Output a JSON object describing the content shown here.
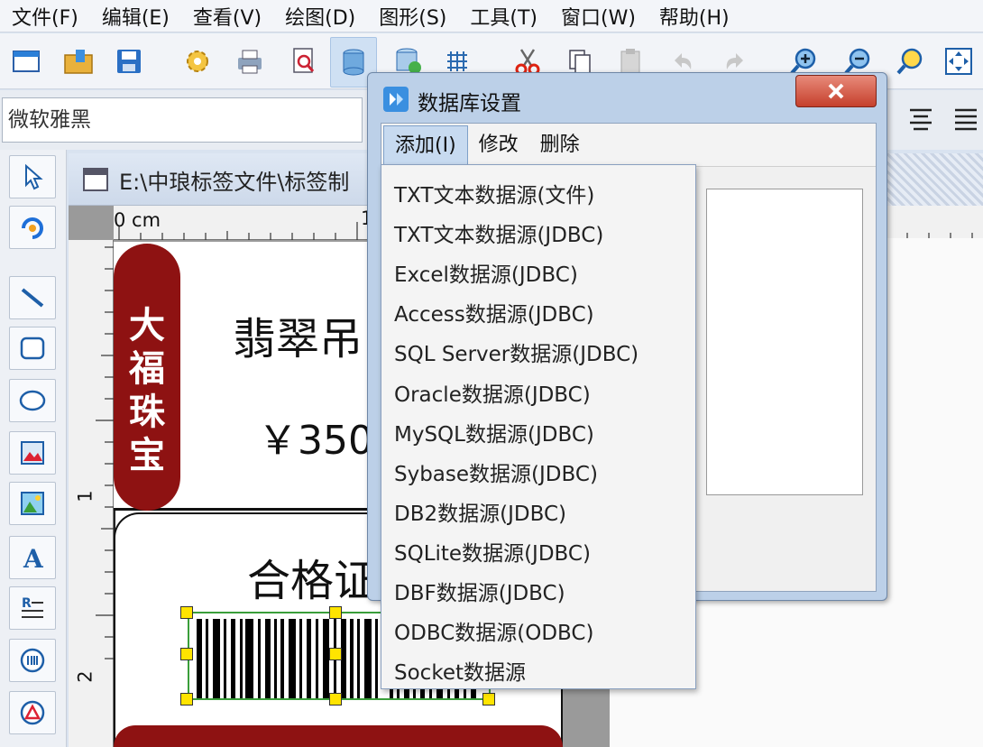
{
  "menu": [
    "文件(F)",
    "编辑(E)",
    "查看(V)",
    "绘图(D)",
    "图形(S)",
    "工具(T)",
    "窗口(W)",
    "帮助(H)"
  ],
  "font": {
    "name": "微软雅黑"
  },
  "document": {
    "title": "E:\\中琅标签文件\\标签制",
    "ruler_labels": [
      "0 cm",
      "1",
      "1",
      "2"
    ],
    "product_name": "翡翠吊",
    "price": "￥350",
    "certificate": "合格证",
    "brand_chars": [
      "大",
      "福",
      "珠",
      "宝"
    ]
  },
  "dialog": {
    "title": "数据库设置",
    "menu": [
      "添加(I)",
      "修改",
      "删除"
    ],
    "dropdown_items": [
      "TXT文本数据源(文件)",
      "TXT文本数据源(JDBC)",
      "Excel数据源(JDBC)",
      "Access数据源(JDBC)",
      "SQL Server数据源(JDBC)",
      "Oracle数据源(JDBC)",
      "MySQL数据源(JDBC)",
      "Sybase数据源(JDBC)",
      "DB2数据源(JDBC)",
      "SQLite数据源(JDBC)",
      "DBF数据源(JDBC)",
      "ODBC数据源(ODBC)",
      "Socket数据源"
    ]
  },
  "colors": {
    "brand_red": "#8e1212",
    "handle_yellow": "#ffe400",
    "selection_green": "#3a9e3a"
  }
}
